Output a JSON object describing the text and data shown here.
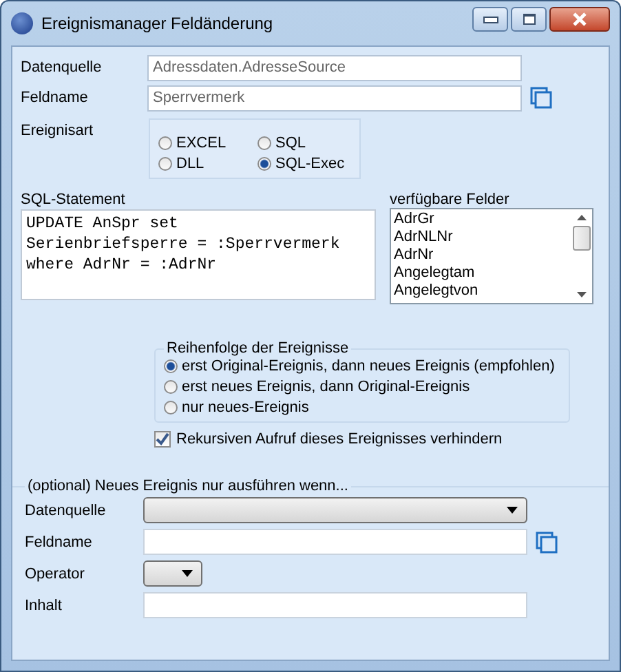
{
  "window": {
    "title": "Ereignismanager Feldänderung"
  },
  "fields": [
    {
      "label": "Datenquelle",
      "value": "Adressdaten.AdresseSource",
      "picker": false
    },
    {
      "label": "Feldname",
      "value": "Sperrvermerk",
      "picker": true
    }
  ],
  "event_type": {
    "label": "Ereignisart",
    "options": [
      {
        "label": "EXCEL",
        "selected": false
      },
      {
        "label": "SQL",
        "selected": false
      },
      {
        "label": "DLL",
        "selected": false
      },
      {
        "label": "SQL-Exec",
        "selected": true
      }
    ]
  },
  "sql": {
    "label": "SQL-Statement",
    "value": "UPDATE AnSpr set\nSerienbriefsperre = :Sperrvermerk\nwhere AdrNr = :AdrNr"
  },
  "available_fields": {
    "label": "verfügbare Felder",
    "items": [
      "AdrGr",
      "AdrNLNr",
      "AdrNr",
      "Angelegtam",
      "Angelegtvon"
    ]
  },
  "order": {
    "label": "Reihenfolge der Ereignisse",
    "options": [
      {
        "label": "erst Original-Ereignis, dann neues Ereignis (empfohlen)",
        "selected": true
      },
      {
        "label": "erst neues Ereignis, dann Original-Ereignis",
        "selected": false
      },
      {
        "label": "nur neues-Ereignis",
        "selected": false
      }
    ]
  },
  "prevent_recursion": {
    "label": "Rekursiven Aufruf dieses Ereignisses verhindern",
    "checked": true
  },
  "condition": {
    "legend": "(optional) Neues Ereignis nur ausführen wenn...",
    "rows": [
      {
        "label": "Datenquelle",
        "kind": "dropdown",
        "picker": false
      },
      {
        "label": "Feldname",
        "kind": "text",
        "picker": true
      },
      {
        "label": "Operator",
        "kind": "small-dropdown",
        "picker": false
      },
      {
        "label": "Inhalt",
        "kind": "text",
        "picker": false
      }
    ]
  }
}
